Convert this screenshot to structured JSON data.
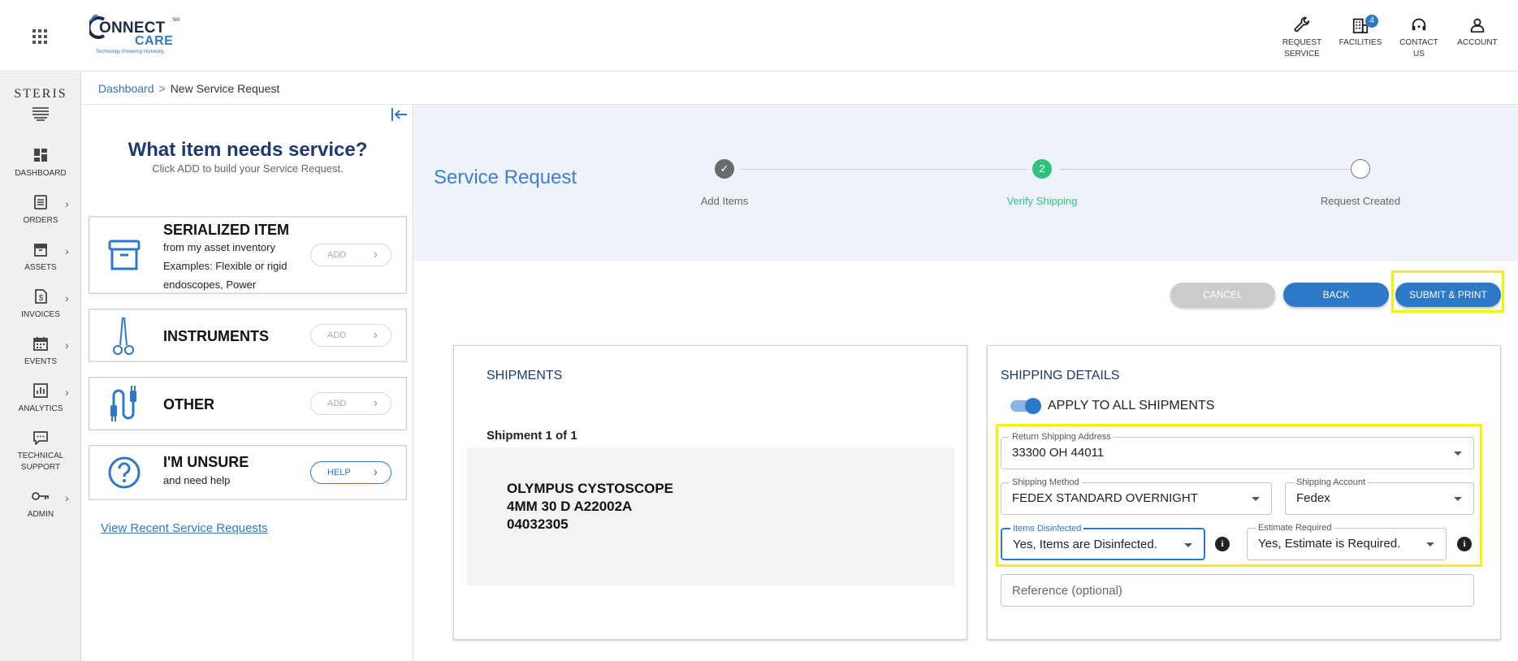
{
  "header": {
    "brand_word": "ONNECT",
    "brand_c": "C",
    "brand_care": "CARE",
    "brand_sm": "SM",
    "brand_tagline": "Technology Powering Humanity",
    "actions": [
      {
        "label1": "REQUEST",
        "label2": "SERVICE",
        "icon": "wrench-icon"
      },
      {
        "label1": "FACILITIES",
        "label2": "",
        "icon": "building-icon",
        "badge": "4"
      },
      {
        "label1": "CONTACT",
        "label2": "US",
        "icon": "headset-icon"
      },
      {
        "label1": "ACCOUNT",
        "label2": "",
        "icon": "person-icon"
      }
    ]
  },
  "sidebar": {
    "brand": "STERIS",
    "items": [
      {
        "label": "DASHBOARD",
        "label2": "",
        "icon": "dashboard-icon",
        "chevron": false
      },
      {
        "label": "ORDERS",
        "label2": "",
        "icon": "orders-icon",
        "chevron": true
      },
      {
        "label": "ASSETS",
        "label2": "",
        "icon": "assets-icon",
        "chevron": true
      },
      {
        "label": "INVOICES",
        "label2": "",
        "icon": "invoice-icon",
        "chevron": true
      },
      {
        "label": "EVENTS",
        "label2": "",
        "icon": "calendar-icon",
        "chevron": true
      },
      {
        "label": "ANALYTICS",
        "label2": "",
        "icon": "analytics-icon",
        "chevron": true
      },
      {
        "label": "TECHNICAL",
        "label2": "SUPPORT",
        "icon": "chat-icon",
        "chevron": false
      },
      {
        "label": "ADMIN",
        "label2": "",
        "icon": "key-icon",
        "chevron": true
      }
    ]
  },
  "breadcrumb": {
    "home": "Dashboard",
    "separator": ">",
    "current": "New Service Request"
  },
  "item_panel": {
    "title": "What item needs service?",
    "subtitle": "Click ADD to build your Service Request.",
    "cards": [
      {
        "title": "SERIALIZED ITEM",
        "desc1": "from my asset inventory",
        "desc2": "Examples: Flexible or rigid",
        "desc3": "endoscopes, Power",
        "button": "ADD"
      },
      {
        "title": "INSTRUMENTS",
        "button": "ADD"
      },
      {
        "title": "OTHER",
        "button": "ADD"
      },
      {
        "title": "I'M UNSURE",
        "desc1": "and need help",
        "button": "HELP"
      }
    ],
    "recent_link": "View Recent Service Requests"
  },
  "stepper": {
    "title": "Service Request",
    "steps": [
      {
        "label": "Add Items",
        "state": "complete",
        "marker": "✓"
      },
      {
        "label": "Verify Shipping",
        "state": "active",
        "marker": "2"
      },
      {
        "label": "Request Created",
        "state": "pending",
        "marker": ""
      }
    ],
    "colors": {
      "complete": "#6b6b6b",
      "active": "#2ec27e",
      "accent": "#3d7fd1"
    }
  },
  "actions": {
    "cancel": "CANCEL",
    "back": "BACK",
    "submit": "SUBMIT & PRINT"
  },
  "shipments": {
    "title": "SHIPMENTS",
    "count_label": "Shipment 1 of 1",
    "item_line1": "OLYMPUS CYSTOSCOPE",
    "item_line2": "4MM 30 D A22002A",
    "item_line3": "04032305"
  },
  "shipping_details": {
    "title": "SHIPPING DETAILS",
    "apply_all_label": "APPLY TO ALL SHIPMENTS",
    "apply_all_on": true,
    "return_address": {
      "label": "Return Shipping Address",
      "value": "33300  OH 44011"
    },
    "shipping_method": {
      "label": "Shipping Method",
      "value": "FEDEX STANDARD OVERNIGHT"
    },
    "shipping_account": {
      "label": "Shipping Account",
      "value": "Fedex"
    },
    "items_disinfected": {
      "label": "Items Disinfected",
      "value": "Yes, Items are Disinfected."
    },
    "estimate_required": {
      "label": "Estimate Required",
      "value": "Yes, Estimate is Required."
    },
    "reference": {
      "placeholder": "Reference (optional)",
      "value": ""
    },
    "info_glyph": "i"
  },
  "colors": {
    "primary": "#2e78c8",
    "highlight": "#f7f200",
    "title_navy": "#1f3a6e"
  }
}
